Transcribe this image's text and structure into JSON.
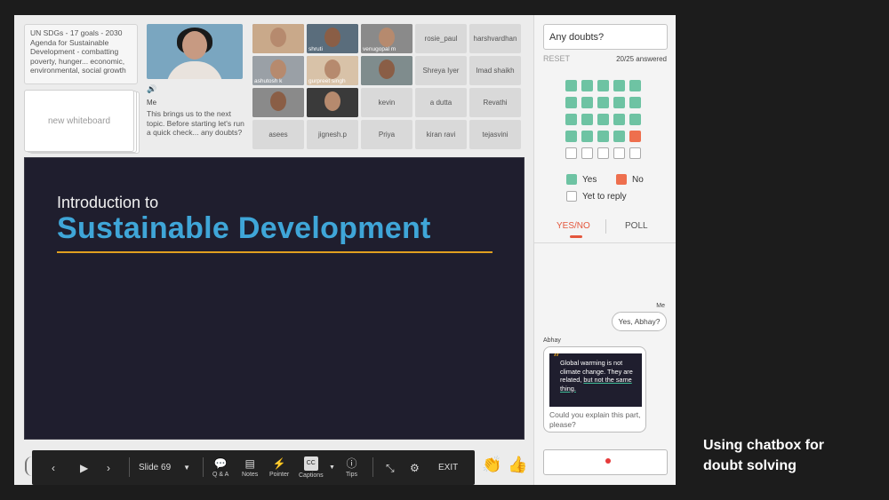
{
  "agenda": {
    "text": "UN SDGs - 17 goals - 2030 Agenda for Sustainable Development - combatting poverty, hunger... economic, environmental, social growth"
  },
  "whiteboard": {
    "label": "new whiteboard"
  },
  "speaker": {
    "name": "Me",
    "message": "This brings us to the next topic. Before starting let's run a quick check... any doubts?"
  },
  "participants": [
    {
      "name": "",
      "video": true
    },
    {
      "name": "shruti",
      "video": true
    },
    {
      "name": "venugopal m",
      "video": true
    },
    {
      "name": "rosie_paul",
      "video": false
    },
    {
      "name": "harshvardhan",
      "video": false
    },
    {
      "name": "ashutosh k",
      "video": true
    },
    {
      "name": "gurpreet singh",
      "video": true
    },
    {
      "name": "",
      "video": true
    },
    {
      "name": "Shreya Iyer",
      "video": false
    },
    {
      "name": "Imad shaikh",
      "video": false
    },
    {
      "name": "",
      "video": true
    },
    {
      "name": "",
      "video": true
    },
    {
      "name": "kevin",
      "video": false
    },
    {
      "name": "a dutta",
      "video": false
    },
    {
      "name": "Revathi",
      "video": false
    },
    {
      "name": "asees",
      "video": false
    },
    {
      "name": "jignesh.p",
      "video": false
    },
    {
      "name": "Priya",
      "video": false
    },
    {
      "name": "kiran ravi",
      "video": false
    },
    {
      "name": "tejasvini",
      "video": false
    }
  ],
  "slide": {
    "intro": "Introduction to",
    "title": "Sustainable Development"
  },
  "toolbar": {
    "slide_label": "Slide 69",
    "qa": "Q & A",
    "notes": "Notes",
    "pointer": "Pointer",
    "captions": "Captions",
    "tips": "Tips",
    "exit": "EXIT",
    "cc": "CC"
  },
  "reactions": [
    "👏",
    "👍"
  ],
  "panel": {
    "question": "Any doubts?",
    "reset": "RESET",
    "answered": "20/25 answered",
    "responses": [
      "yes",
      "yes",
      "yes",
      "yes",
      "yes",
      "yes",
      "yes",
      "yes",
      "yes",
      "yes",
      "yes",
      "yes",
      "yes",
      "yes",
      "yes",
      "yes",
      "yes",
      "yes",
      "yes",
      "no",
      "pending",
      "pending",
      "pending",
      "pending",
      "pending"
    ],
    "legend_yes": "Yes",
    "legend_no": "No",
    "legend_pending": "Yet to reply",
    "tab_yesno": "YES/NO",
    "tab_poll": "POLL",
    "colors": {
      "yes": "#6ec3a3",
      "no": "#ee6f4e",
      "accent": "#e4573d"
    }
  },
  "chat": {
    "me_label": "Me",
    "me_message": "Yes, Abhay?",
    "abhay_label": "Abhay",
    "quote_line1": "Global warming is not climate change. They are related, ",
    "quote_underlined": "but not the same thing.",
    "abhay_message": "Could you explain this part, please?"
  },
  "caption": {
    "line1": "Using chatbox for",
    "line2": "doubt solving"
  }
}
